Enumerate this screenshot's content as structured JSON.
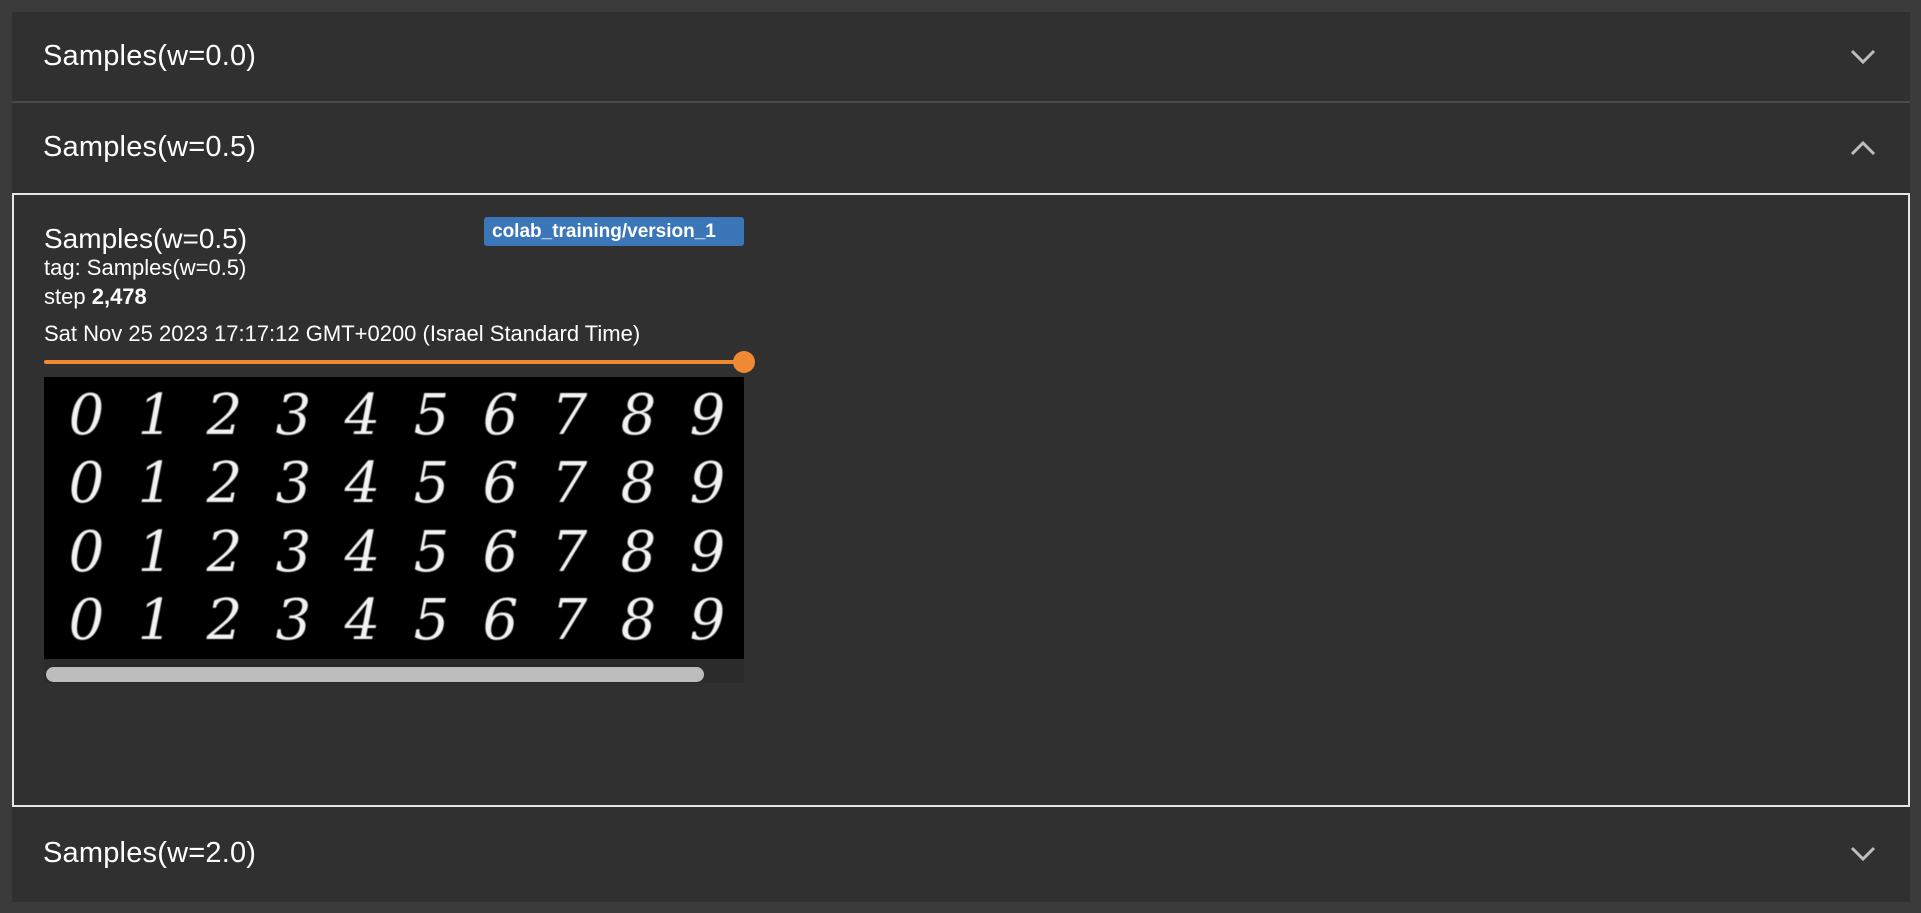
{
  "sections": [
    {
      "title": "Samples(w=0.0)",
      "expanded": false
    },
    {
      "title": "Samples(w=0.5)",
      "expanded": true
    },
    {
      "title": "Samples(w=2.0)",
      "expanded": false
    }
  ],
  "card": {
    "title": "Samples(w=0.5)",
    "run": "colab_training/version_1",
    "tag_label": "tag: Samples(w=0.5)",
    "step_prefix": "step",
    "step_value": "2,478",
    "timestamp": "Sat Nov 25 2023 17:17:12 GMT+0200 (Israel Standard Time)",
    "slider_position": 1.0,
    "image_digits": [
      [
        "0",
        "1",
        "2",
        "3",
        "4",
        "5",
        "6",
        "7",
        "8",
        "9"
      ],
      [
        "0",
        "1",
        "2",
        "3",
        "4",
        "5",
        "6",
        "7",
        "8",
        "9"
      ],
      [
        "0",
        "1",
        "2",
        "3",
        "4",
        "5",
        "6",
        "7",
        "8",
        "9"
      ],
      [
        "0",
        "1",
        "2",
        "3",
        "4",
        "5",
        "6",
        "7",
        "8",
        "9"
      ]
    ],
    "scroll_fraction": 0.94
  },
  "colors": {
    "background": "#303030",
    "accent": "#ef8a33",
    "run_badge": "#3b76b8"
  },
  "icons": {
    "collapsed": "chevron-down-icon",
    "expanded": "chevron-up-icon"
  }
}
